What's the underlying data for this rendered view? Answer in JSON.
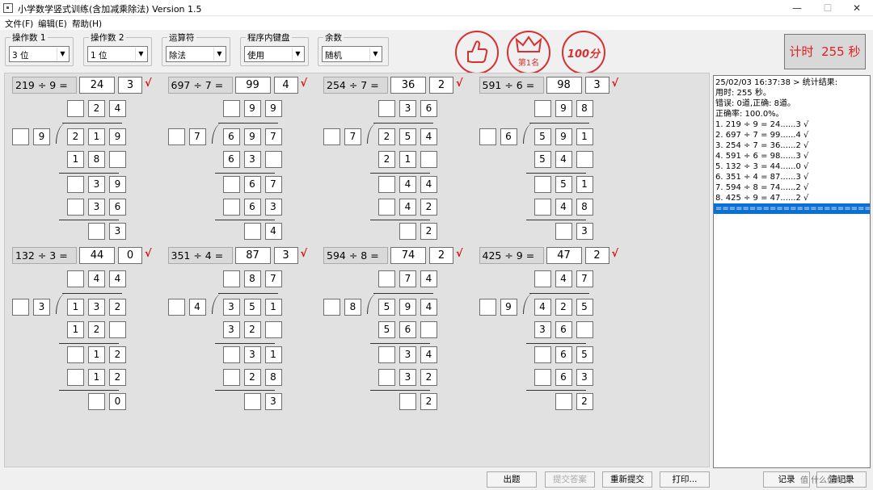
{
  "window": {
    "title": "小学数学竖式训练(含加减乘除法) Version 1.5",
    "minimize": "—",
    "maximize": "☐",
    "close": "✕"
  },
  "menu": [
    "文件(F)",
    "编辑(E)",
    "帮助(H)"
  ],
  "controls": [
    {
      "label": "操作数 1",
      "value": "3 位"
    },
    {
      "label": "操作数 2",
      "value": "1 位"
    },
    {
      "label": "运算符",
      "value": "除法"
    },
    {
      "label": "程序内键盘",
      "value": "使用"
    },
    {
      "label": "余数",
      "value": "随机"
    }
  ],
  "stamps": {
    "rank_text": "第1名",
    "score_text": "100分"
  },
  "timer": {
    "label": "计时",
    "value": "255 秒"
  },
  "check_mark": "√",
  "problems": [
    {
      "eq": "219 ÷ 9 =",
      "q": "24",
      "r": "3",
      "qd": [
        "",
        "2",
        "4"
      ],
      "div": [
        "",
        "9"
      ],
      "dvd": [
        "2",
        "1",
        "9"
      ],
      "s1": [
        "1",
        "8",
        ""
      ],
      "b1": [
        "",
        "3",
        "9"
      ],
      "s2": [
        "",
        "3",
        "6"
      ],
      "rem": [
        "",
        "3"
      ]
    },
    {
      "eq": "697 ÷ 7 =",
      "q": "99",
      "r": "4",
      "qd": [
        "",
        "9",
        "9"
      ],
      "div": [
        "",
        "7"
      ],
      "dvd": [
        "6",
        "9",
        "7"
      ],
      "s1": [
        "6",
        "3",
        ""
      ],
      "b1": [
        "",
        "6",
        "7"
      ],
      "s2": [
        "",
        "6",
        "3"
      ],
      "rem": [
        "",
        "4"
      ]
    },
    {
      "eq": "254 ÷ 7 =",
      "q": "36",
      "r": "2",
      "qd": [
        "",
        "3",
        "6"
      ],
      "div": [
        "",
        "7"
      ],
      "dvd": [
        "2",
        "5",
        "4"
      ],
      "s1": [
        "2",
        "1",
        ""
      ],
      "b1": [
        "",
        "4",
        "4"
      ],
      "s2": [
        "",
        "4",
        "2"
      ],
      "rem": [
        "",
        "2"
      ]
    },
    {
      "eq": "591 ÷ 6 =",
      "q": "98",
      "r": "3",
      "qd": [
        "",
        "9",
        "8"
      ],
      "div": [
        "",
        "6"
      ],
      "dvd": [
        "5",
        "9",
        "1"
      ],
      "s1": [
        "5",
        "4",
        ""
      ],
      "b1": [
        "",
        "5",
        "1"
      ],
      "s2": [
        "",
        "4",
        "8"
      ],
      "rem": [
        "",
        "3"
      ]
    },
    {
      "eq": "132 ÷ 3 =",
      "q": "44",
      "r": "0",
      "qd": [
        "",
        "4",
        "4"
      ],
      "div": [
        "",
        "3"
      ],
      "dvd": [
        "1",
        "3",
        "2"
      ],
      "s1": [
        "1",
        "2",
        ""
      ],
      "b1": [
        "",
        "1",
        "2"
      ],
      "s2": [
        "",
        "1",
        "2"
      ],
      "rem": [
        "",
        "0"
      ]
    },
    {
      "eq": "351 ÷ 4 =",
      "q": "87",
      "r": "3",
      "qd": [
        "",
        "8",
        "7"
      ],
      "div": [
        "",
        "4"
      ],
      "dvd": [
        "3",
        "5",
        "1"
      ],
      "s1": [
        "3",
        "2",
        ""
      ],
      "b1": [
        "",
        "3",
        "1"
      ],
      "s2": [
        "",
        "2",
        "8"
      ],
      "rem": [
        "",
        "3"
      ]
    },
    {
      "eq": "594 ÷ 8 =",
      "q": "74",
      "r": "2",
      "qd": [
        "",
        "7",
        "4"
      ],
      "div": [
        "",
        "8"
      ],
      "dvd": [
        "5",
        "9",
        "4"
      ],
      "s1": [
        "5",
        "6",
        ""
      ],
      "b1": [
        "",
        "3",
        "4"
      ],
      "s2": [
        "",
        "3",
        "2"
      ],
      "rem": [
        "",
        "2"
      ]
    },
    {
      "eq": "425 ÷ 9 =",
      "q": "47",
      "r": "2",
      "qd": [
        "",
        "4",
        "7"
      ],
      "div": [
        "",
        "9"
      ],
      "dvd": [
        "4",
        "2",
        "5"
      ],
      "s1": [
        "3",
        "6",
        ""
      ],
      "b1": [
        "",
        "6",
        "5"
      ],
      "s2": [
        "",
        "6",
        "3"
      ],
      "rem": [
        "",
        "2"
      ]
    }
  ],
  "log": {
    "lines": [
      "25/02/03 16:37:38 > 统计结果:",
      "用时: 255 秒。",
      "错误: 0道,正确: 8道。",
      "正确率: 100.0%。",
      "1. 219 ÷ 9 = 24......3 √",
      "2. 697 ÷ 7 = 99......4 √",
      "3. 254 ÷ 7 = 36......2 √",
      "4. 591 ÷ 6 = 98......3 √",
      "5. 132 ÷ 3 = 44......0 √",
      "6. 351 ÷ 4 = 87......3 √",
      "7. 594 ÷ 8 = 74......2 √",
      "8. 425 ÷ 9 = 47......2 √"
    ],
    "selected": "================================"
  },
  "buttons": [
    {
      "label": "出题",
      "enabled": true
    },
    {
      "label": "提交答案",
      "enabled": false
    },
    {
      "label": "重新提交",
      "enabled": true
    },
    {
      "label": "打印...",
      "enabled": true
    },
    {
      "label": "记录",
      "enabled": true
    },
    {
      "label": "清记录",
      "enabled": true
    }
  ],
  "watermark": "值 什么值得买"
}
